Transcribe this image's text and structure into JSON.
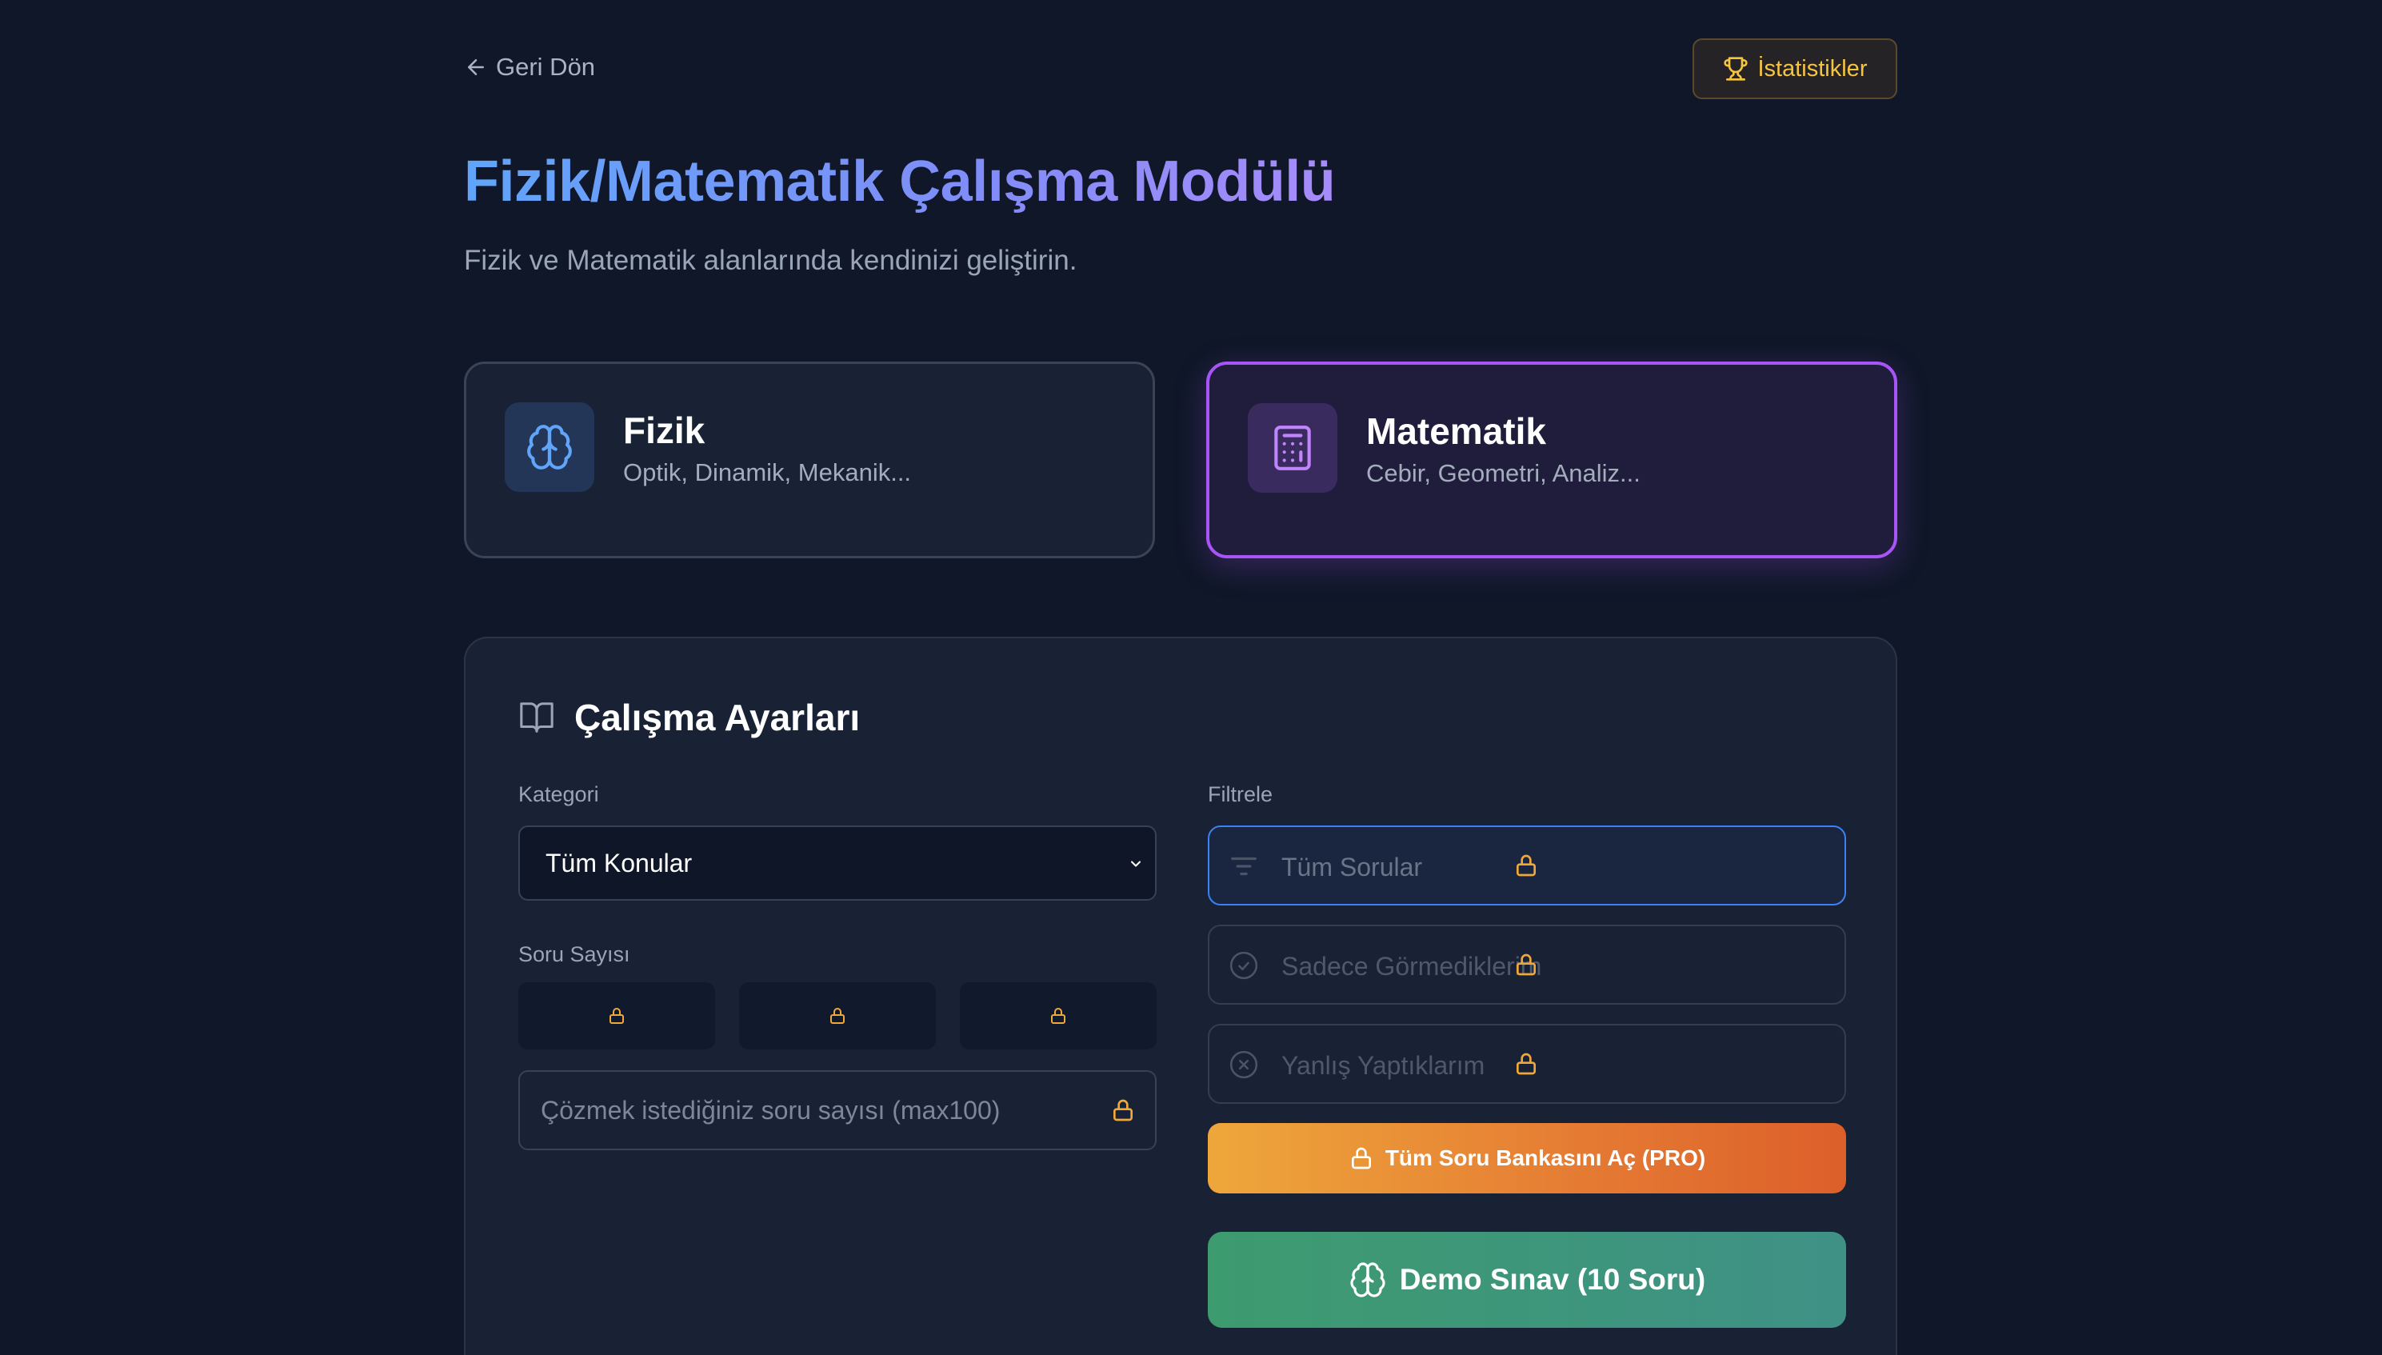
{
  "header": {
    "back_label": "Geri Dön",
    "stats_label": "İstatistikler"
  },
  "hero": {
    "title": "Fizik/Matematik Çalışma Modülü",
    "subtitle": "Fizik ve Matematik alanlarında kendinizi geliştirin."
  },
  "subjects": [
    {
      "name": "Fizik",
      "topics": "Optik, Dinamik, Mekanik...",
      "icon": "brain-icon",
      "selected": false
    },
    {
      "name": "Matematik",
      "topics": "Cebir, Geometri, Analiz...",
      "icon": "calculator-icon",
      "selected": true
    }
  ],
  "settings": {
    "title": "Çalışma Ayarları",
    "category_label": "Kategori",
    "category_value": "Tüm Konular",
    "question_count_label": "Soru Sayısı",
    "question_count_placeholder": "Çözmek istediğiniz soru sayısı (max100)",
    "filter_label": "Filtrele",
    "filters": [
      {
        "label": "Tüm Sorular",
        "icon": "filter-icon",
        "locked": true,
        "active": true
      },
      {
        "label": "Sadece Görmediklerim",
        "icon": "check-circle-icon",
        "locked": true,
        "active": false
      },
      {
        "label": "Yanlış Yaptıklarım",
        "icon": "x-circle-icon",
        "locked": true,
        "active": false
      }
    ],
    "pro_button": "Tüm Soru Bankasını Aç (PRO)",
    "demo_button": "Demo Sınav (10 Soru)"
  },
  "colors": {
    "background": "#101728",
    "accent_purple": "#a855f7",
    "accent_blue": "#3b82f6",
    "lock_orange": "#f0a83a",
    "stats_gold": "#f5c542"
  }
}
